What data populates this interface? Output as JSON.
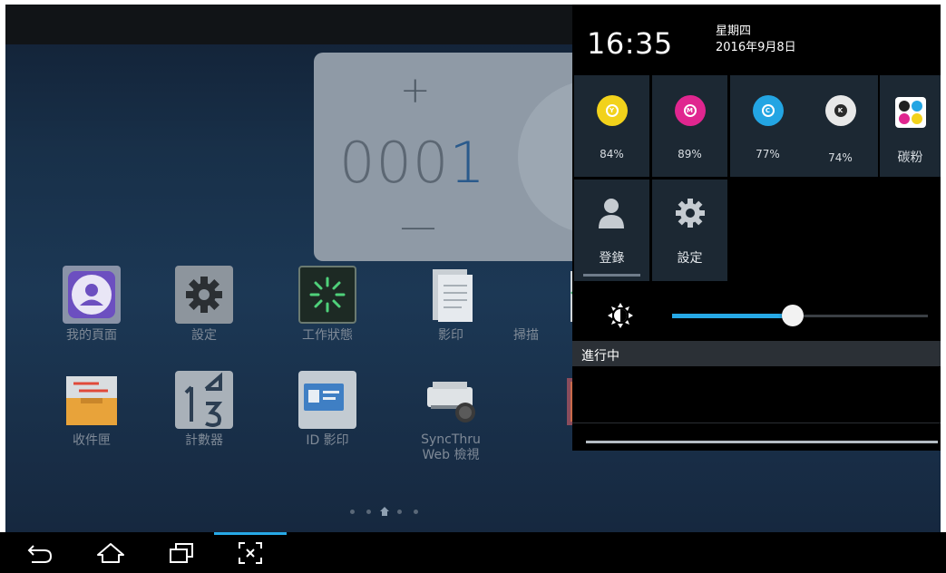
{
  "counter": {
    "plus": "+",
    "minus": "—",
    "value_lead": "000",
    "value_last": "1"
  },
  "apps": [
    {
      "label": "我的頁面"
    },
    {
      "label": "設定"
    },
    {
      "label": "工作狀態"
    },
    {
      "label": "影印"
    },
    {
      "label": "掃描"
    },
    {
      "label": "收件匣"
    },
    {
      "label": "計數器"
    },
    {
      "label": "ID 影印"
    },
    {
      "label": "SyncThru"
    },
    {
      "label": "Web 檢視"
    }
  ],
  "panel": {
    "time": "16:35",
    "weekday": "星期四",
    "date": "2016年9月8日",
    "toners": [
      {
        "letter": "Y",
        "percent": "84%",
        "color": "#f2d21b"
      },
      {
        "letter": "M",
        "percent": "89%",
        "color": "#e0268f"
      },
      {
        "letter": "C",
        "percent": "77%",
        "color": "#23a5e3"
      },
      {
        "letter": "K",
        "percent": "74%",
        "color": "#2a2a2a"
      }
    ],
    "toner_label": "碳粉",
    "login_label": "登錄",
    "settings_label": "設定",
    "brightness_level": 0.47,
    "in_progress_label": "進行中"
  },
  "colors": {
    "accent": "#27a9e6",
    "panel_tile": "#1c2833"
  }
}
